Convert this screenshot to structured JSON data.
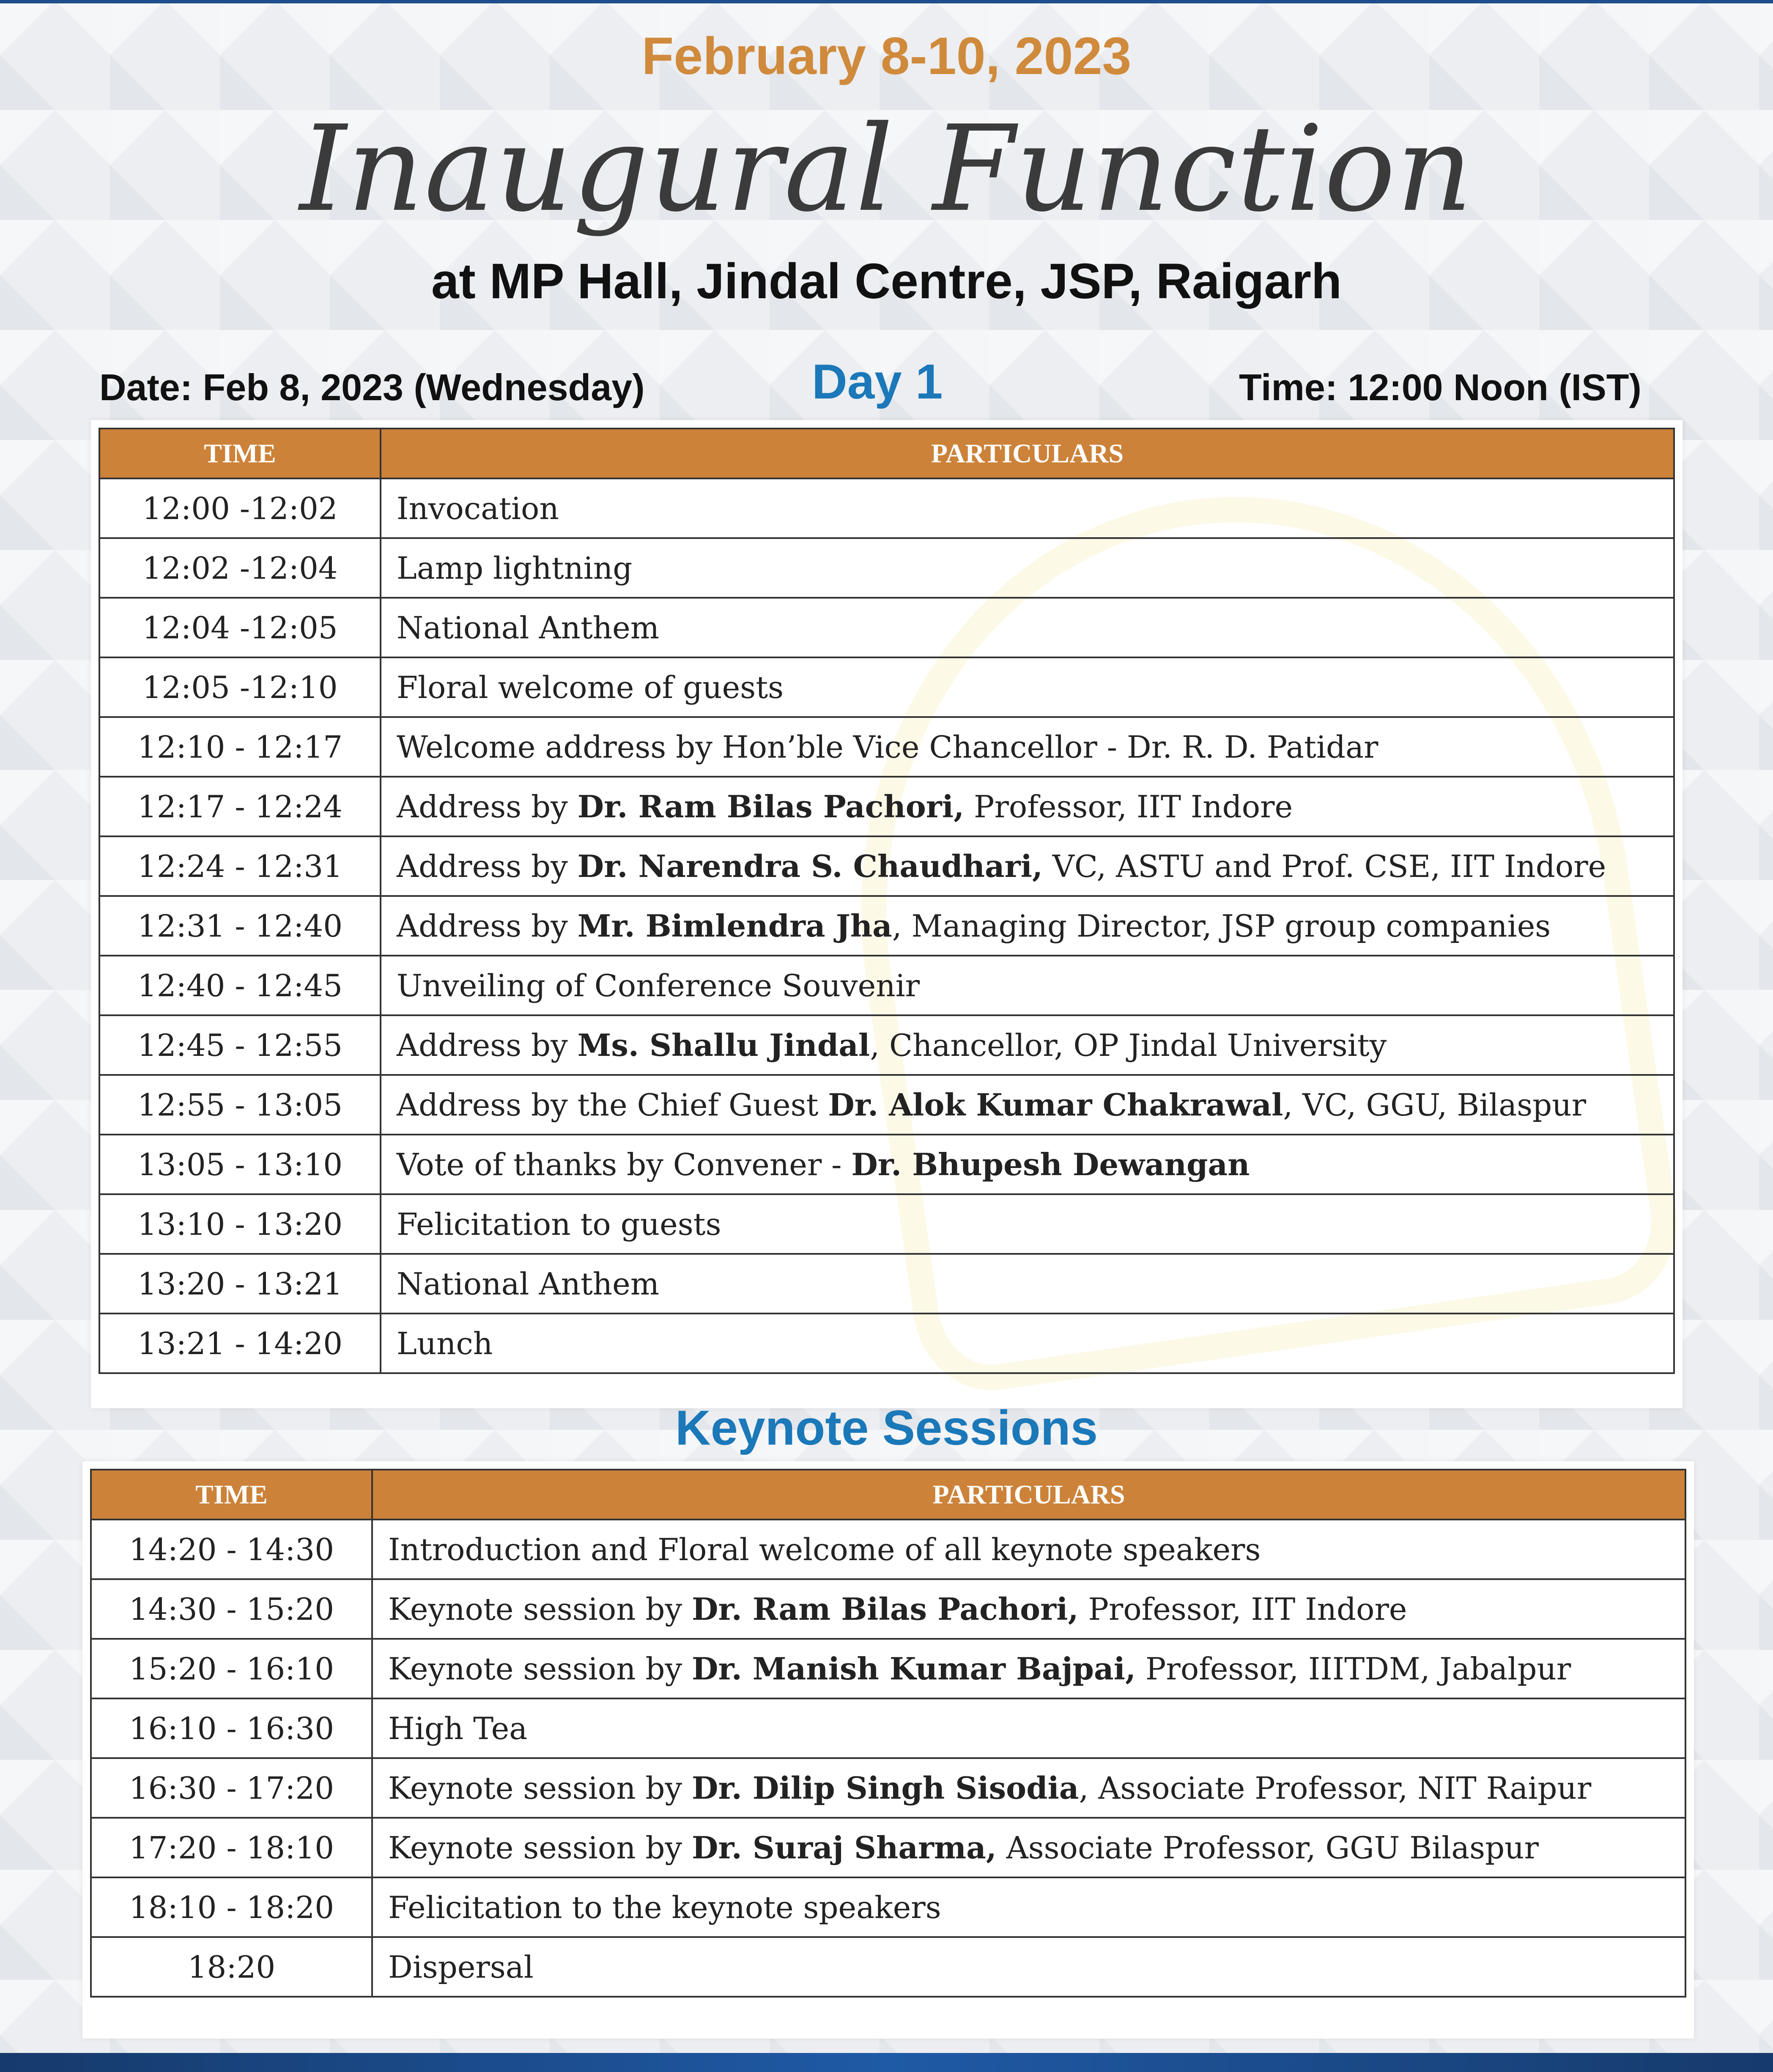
{
  "header": {
    "dates": "February 8-10, 2023",
    "title": "Inaugural Function",
    "venue": "at MP Hall, Jindal Centre, JSP, Raigarh",
    "date_label": "Date: Feb 8, 2023 (Wednesday)",
    "day_label": "Day 1",
    "time_label": "Time: 12:00 Noon (IST)"
  },
  "inaugural_table": {
    "col_time": "TIME",
    "col_particulars": "PARTICULARS",
    "rows": [
      {
        "time": "12:00 -12:02",
        "pre": "Invocation",
        "bold": "",
        "post": ""
      },
      {
        "time": "12:02 -12:04",
        "pre": "Lamp lightning",
        "bold": "",
        "post": ""
      },
      {
        "time": "12:04 -12:05",
        "pre": "National Anthem",
        "bold": "",
        "post": ""
      },
      {
        "time": "12:05 -12:10",
        "pre": "Floral welcome of guests",
        "bold": "",
        "post": ""
      },
      {
        "time": "12:10 - 12:17",
        "pre": "Welcome address by Hon’ble Vice Chancellor -  Dr. R. D. Patidar",
        "bold": "",
        "post": ""
      },
      {
        "time": "12:17 - 12:24",
        "pre": "Address by ",
        "bold": "Dr. Ram Bilas Pachori,",
        "post": " Professor, IIT Indore"
      },
      {
        "time": "12:24 - 12:31",
        "pre": "Address by ",
        "bold": "Dr. Narendra S. Chaudhari,",
        "post": " VC, ASTU and Prof. CSE, IIT Indore"
      },
      {
        "time": "12:31 - 12:40",
        "pre": "Address by ",
        "bold": "Mr. Bimlendra Jha",
        "post": ", Managing Director, JSP group companies"
      },
      {
        "time": "12:40 - 12:45",
        "pre": "Unveiling of Conference Souvenir",
        "bold": "",
        "post": ""
      },
      {
        "time": "12:45 - 12:55",
        "pre": "Address by ",
        "bold": "Ms. Shallu Jindal",
        "post": ", Chancellor, OP Jindal University"
      },
      {
        "time": "12:55 - 13:05",
        "pre": "Address by the Chief Guest ",
        "bold": "Dr. Alok Kumar Chakrawal",
        "post": ", VC, GGU, Bilaspur"
      },
      {
        "time": "13:05 - 13:10",
        "pre": "Vote of thanks by Convener - ",
        "bold": "Dr. Bhupesh Dewangan",
        "post": ""
      },
      {
        "time": "13:10 - 13:20",
        "pre": "Felicitation to guests",
        "bold": "",
        "post": ""
      },
      {
        "time": "13:20 - 13:21",
        "pre": "National Anthem",
        "bold": "",
        "post": ""
      },
      {
        "time": "13:21 - 14:20",
        "pre": "Lunch",
        "bold": "",
        "post": ""
      }
    ]
  },
  "keynote": {
    "title": "Keynote Sessions",
    "col_time": "TIME",
    "col_particulars": "PARTICULARS",
    "rows": [
      {
        "time": "14:20 - 14:30",
        "pre": "Introduction and Floral welcome of all keynote speakers",
        "bold": "",
        "post": ""
      },
      {
        "time": "14:30 - 15:20",
        "pre": "Keynote session by ",
        "bold": "Dr. Ram Bilas Pachori,",
        "post": " Professor, IIT Indore"
      },
      {
        "time": "15:20 - 16:10",
        "pre": "Keynote session by ",
        "bold": "Dr. Manish Kumar Bajpai,",
        "post": " Professor, IIITDM, Jabalpur"
      },
      {
        "time": "16:10 - 16:30",
        "pre": "High Tea",
        "bold": "",
        "post": ""
      },
      {
        "time": "16:30 - 17:20",
        "pre": "Keynote session by ",
        "bold": "Dr. Dilip Singh Sisodia",
        "post": ", Associate Professor, NIT Raipur"
      },
      {
        "time": "17:20 - 18:10",
        "pre": "Keynote session by ",
        "bold": "Dr. Suraj Sharma,",
        "post": " Associate Professor, GGU Bilaspur"
      },
      {
        "time": "18:10 - 18:20",
        "pre": "Felicitation to the keynote speakers",
        "bold": "",
        "post": ""
      },
      {
        "time": "18:20",
        "pre": "Dispersal",
        "bold": "",
        "post": ""
      }
    ]
  }
}
